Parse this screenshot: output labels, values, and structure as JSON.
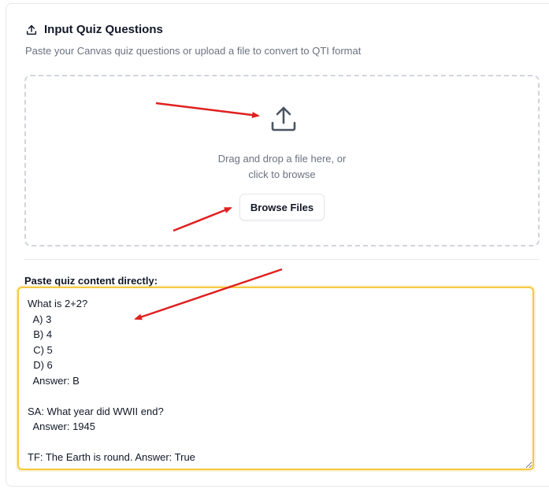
{
  "header": {
    "title": "Input Quiz Questions",
    "subtitle": "Paste your Canvas quiz questions or upload a file to convert to QTI format",
    "icon": "upload-icon"
  },
  "dropzone": {
    "icon": "upload-icon",
    "line1": "Drag and drop a file here, or",
    "line2": "click to browse",
    "browse_label": "Browse Files"
  },
  "paste": {
    "label": "Paste quiz content directly:",
    "value": "What is 2+2?\n  A) 3\n  B) 4\n  C) 5\n  D) 6\n  Answer: B\n\nSA: What year did WWII end?\n  Answer: 1945\n\nTF: The Earth is round. Answer: True"
  },
  "colors": {
    "accent_border": "#f5c842",
    "annotation_arrow": "#e02020",
    "muted_text": "#6b7280"
  }
}
